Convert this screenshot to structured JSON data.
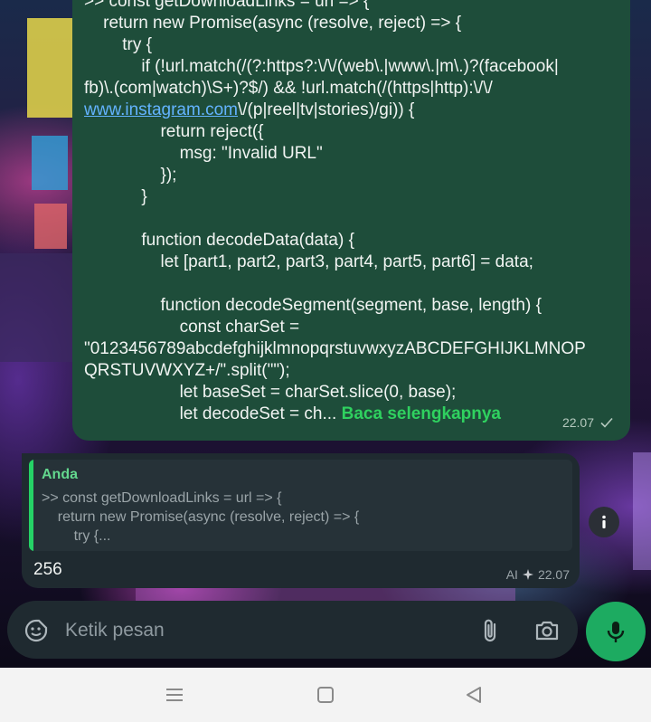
{
  "code_message": {
    "lines": [
      ">> const getDownloadLinks = url => {",
      "    return new Promise(async (resolve, reject) => {",
      "        try {",
      "            if (!url.match(/(?:https?:\\/\\/(web\\.|www\\.|m\\.)?(facebook|",
      "fb)\\.(com|watch)\\S+)?$/) && !url.match(/(https|http):\\/\\/",
      "",
      "                return reject({",
      "                    msg: \"Invalid URL\"",
      "                });",
      "            }",
      "",
      "            function decodeData(data) {",
      "                let [part1, part2, part3, part4, part5, part6] = data;",
      "",
      "                function decodeSegment(segment, base, length) {",
      "                    const charSet =",
      "\"0123456789abcdefghijklmnopqrstuvwxyzABCDEFGHIJKLMNOP",
      "QRSTUVWXYZ+/\".split(\"\");",
      "                    let baseSet = charSet.slice(0, base);"
    ],
    "link_text": "www.instagram.com",
    "link_suffix": "\\/(p|reel|tv|stories)/gi)) {",
    "last_line": "                    let decodeSet = ch...",
    "read_more": "Baca selengkapnya",
    "time": "22.07"
  },
  "reply_message": {
    "quoted_author": "Anda",
    "quoted_text": ">> const getDownloadLinks = url => {\n    return new Promise(async (resolve, reject) => {\n        try {...",
    "text": "256",
    "ai_label": "AI",
    "time": "22.07"
  },
  "composer": {
    "placeholder": "Ketik pesan"
  },
  "colors": {
    "sent_bubble": "#1e4d3a",
    "received_bubble": "#1f2a30",
    "accent_green": "#1dab61",
    "link_blue": "#63b3ff"
  },
  "icons": [
    "check-icon",
    "ai-sparkle-icon",
    "info-icon",
    "emoji-sticker-icon",
    "attach-icon",
    "camera-icon",
    "mic-icon",
    "recents-icon",
    "home-icon",
    "back-icon"
  ]
}
